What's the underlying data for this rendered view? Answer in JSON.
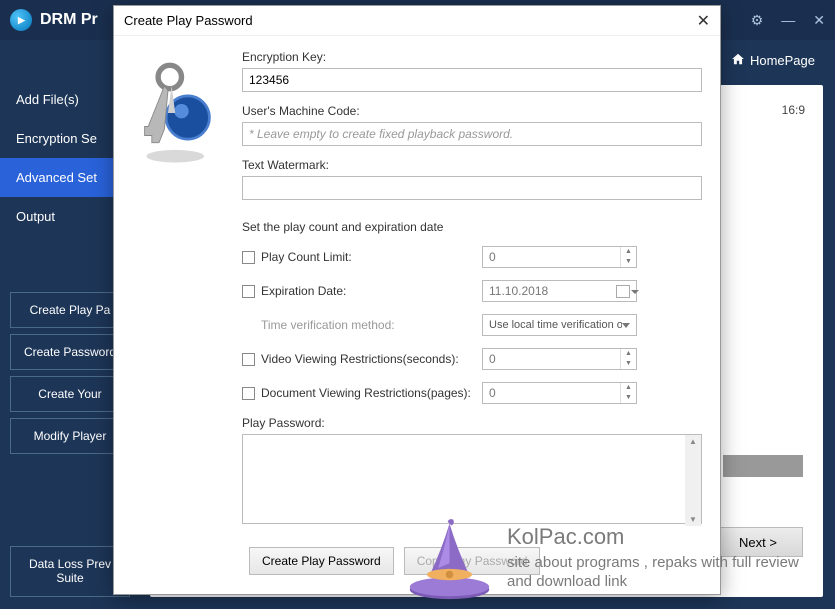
{
  "app": {
    "title": "DRM Pr",
    "homepage": "HomePage"
  },
  "sidebar": {
    "items": [
      {
        "label": "Add File(s)"
      },
      {
        "label": "Encryption Se"
      },
      {
        "label": "Advanced Set"
      },
      {
        "label": "Output"
      }
    ],
    "buttons": [
      {
        "label": "Create Play Pa"
      },
      {
        "label": "Create Password"
      },
      {
        "label": "Create Your"
      },
      {
        "label": "Modify Player"
      }
    ],
    "bottom": {
      "label": "Data Loss Prev Suite"
    }
  },
  "main": {
    "ratio_hint": "16:9",
    "next": "Next >"
  },
  "dialog": {
    "title": "Create Play Password",
    "labels": {
      "enc_key": "Encryption Key:",
      "machine": "User's Machine Code:",
      "watermark": "Text Watermark:",
      "section": "Set the play count and expiration date",
      "play_count": "Play Count Limit:",
      "expiration": "Expiration Date:",
      "time_method": "Time verification method:",
      "video_restrict": "Video Viewing Restrictions(seconds):",
      "doc_restrict": "Document Viewing Restrictions(pages):",
      "play_password": "Play Password:"
    },
    "values": {
      "enc_key": "123456",
      "machine_placeholder": "* Leave empty to create fixed playback password.",
      "watermark": "",
      "play_count": "0",
      "expiration": "11.10.2018",
      "time_method": "Use local time verification only",
      "video_restrict": "0",
      "doc_restrict": "0",
      "play_password": ""
    },
    "buttons": {
      "create": "Create Play Password",
      "copy": "Copy Play Password"
    }
  },
  "watermark": {
    "title": "KolPac.com",
    "sub": "site about programs , repaks with full review and download link"
  }
}
